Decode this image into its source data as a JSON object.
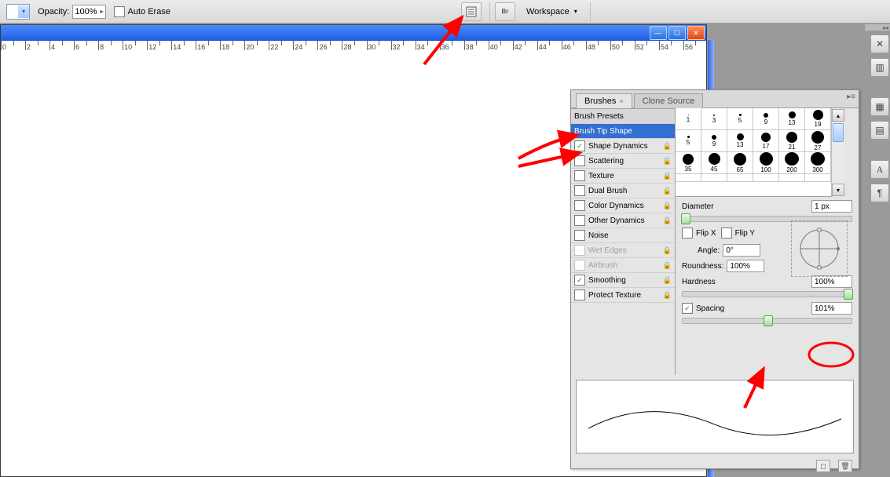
{
  "toolbar": {
    "opacity_label": "Opacity:",
    "opacity_value": "100%",
    "auto_erase": "Auto Erase",
    "workspace": "Workspace"
  },
  "ruler": {
    "start": 0,
    "end": 58,
    "step": 2
  },
  "panel": {
    "tabs": {
      "brushes": "Brushes",
      "clone": "Clone Source"
    },
    "sections": {
      "presets": "Brush Presets",
      "tip": "Brush Tip Shape",
      "options": [
        {
          "label": "Shape Dynamics",
          "checked": true,
          "lock": true
        },
        {
          "label": "Scattering",
          "checked": false,
          "lock": true
        },
        {
          "label": "Texture",
          "checked": false,
          "lock": true
        },
        {
          "label": "Dual Brush",
          "checked": false,
          "lock": true
        },
        {
          "label": "Color Dynamics",
          "checked": false,
          "lock": true
        },
        {
          "label": "Other Dynamics",
          "checked": false,
          "lock": true
        },
        {
          "label": "Noise",
          "checked": false,
          "lock": false
        },
        {
          "label": "Wet Edges",
          "checked": false,
          "lock": true,
          "disabled": true
        },
        {
          "label": "Airbrush",
          "checked": false,
          "lock": true,
          "disabled": true
        },
        {
          "label": "Smoothing",
          "checked": true,
          "lock": true
        },
        {
          "label": "Protect Texture",
          "checked": false,
          "lock": true
        }
      ]
    },
    "grid": [
      {
        "d": 1,
        "l": "1"
      },
      {
        "d": 2,
        "l": "3"
      },
      {
        "d": 3,
        "l": "5"
      },
      {
        "d": 6,
        "l": "9"
      },
      {
        "d": 9,
        "l": "13"
      },
      {
        "d": 13,
        "l": "19"
      },
      {
        "d": 3,
        "l": "5"
      },
      {
        "d": 6,
        "l": "9"
      },
      {
        "d": 9,
        "l": "13"
      },
      {
        "d": 12,
        "l": "17"
      },
      {
        "d": 14,
        "l": "21"
      },
      {
        "d": 16,
        "l": "27"
      },
      {
        "d": 14,
        "l": "35"
      },
      {
        "d": 15,
        "l": "45"
      },
      {
        "d": 16,
        "l": "65"
      },
      {
        "d": 17,
        "l": "100"
      },
      {
        "d": 18,
        "l": "200"
      },
      {
        "d": 18,
        "l": "300"
      }
    ],
    "props": {
      "diameter_label": "Diameter",
      "diameter_value": "1 px",
      "flipx": "Flip X",
      "flipy": "Flip Y",
      "angle_label": "Angle:",
      "angle_value": "0°",
      "roundness_label": "Roundness:",
      "roundness_value": "100%",
      "hardness_label": "Hardness",
      "hardness_value": "100%",
      "spacing_label": "Spacing",
      "spacing_value": "101%"
    }
  }
}
